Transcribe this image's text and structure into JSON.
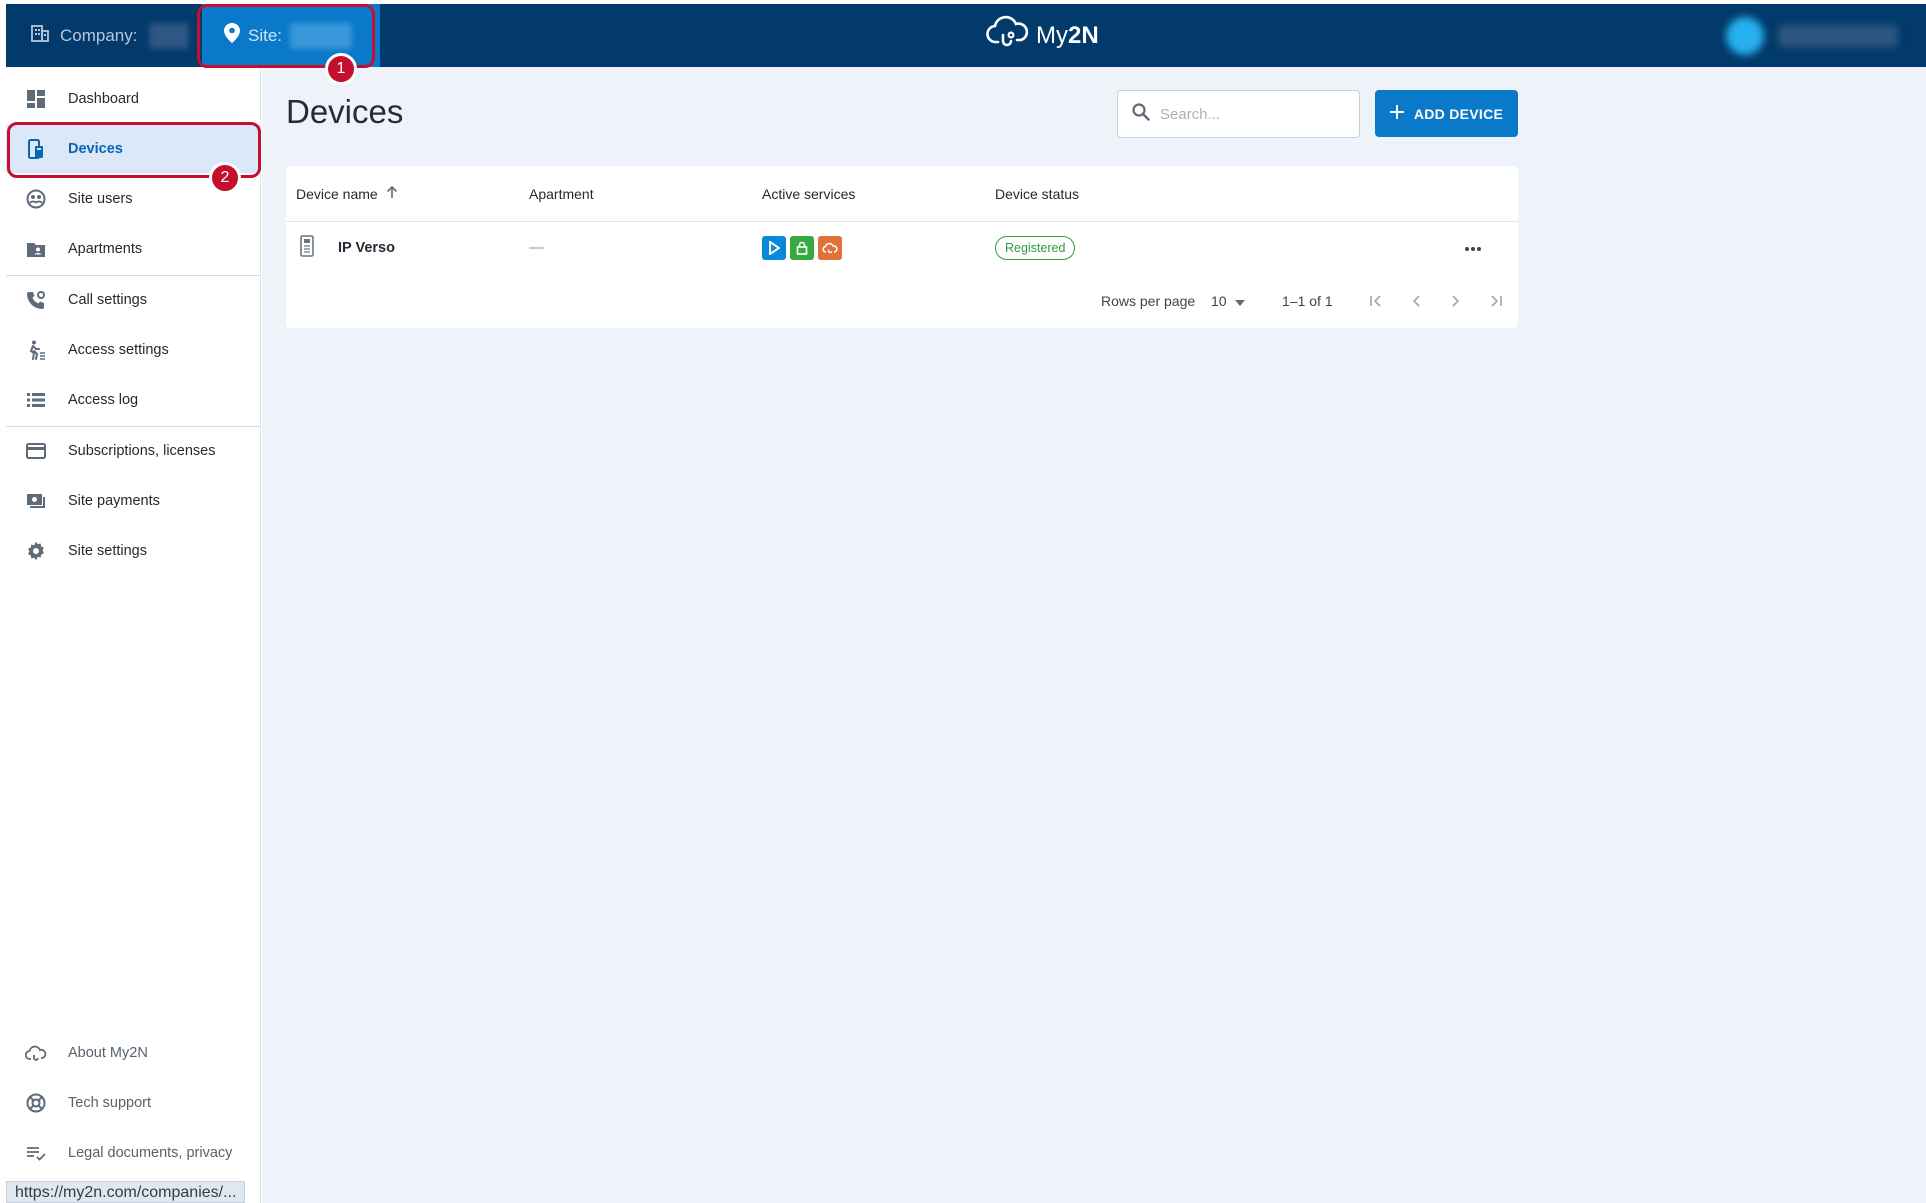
{
  "topbar": {
    "company_label": "Company:",
    "site_label": "Site:",
    "logo_prefix": "My",
    "logo_bold": "2N"
  },
  "annotations": {
    "badge1": "1",
    "badge2": "2"
  },
  "sidebar": {
    "items": [
      {
        "label": "Dashboard"
      },
      {
        "label": "Devices"
      },
      {
        "label": "Site users"
      },
      {
        "label": "Apartments"
      },
      {
        "label": "Call settings"
      },
      {
        "label": "Access settings"
      },
      {
        "label": "Access log"
      },
      {
        "label": "Subscriptions, licenses"
      },
      {
        "label": "Site payments"
      },
      {
        "label": "Site settings"
      }
    ],
    "footer": [
      {
        "label": "About My2N"
      },
      {
        "label": "Tech support"
      },
      {
        "label": "Legal documents, privacy"
      }
    ]
  },
  "main": {
    "title": "Devices",
    "search_placeholder": "Search...",
    "add_button": "ADD DEVICE",
    "table": {
      "columns": [
        "Device name",
        "Apartment",
        "Active services",
        "Device status"
      ],
      "rows": [
        {
          "device_name": "IP Verso",
          "apartment": "—",
          "status": "Registered"
        }
      ]
    },
    "pagination": {
      "rows_per_page_label": "Rows per page",
      "rows_per_page_value": "10",
      "range": "1–1 of 1"
    }
  },
  "statusbar": {
    "url": "https://my2n.com/companies/..."
  },
  "colors": {
    "accent": "#0a79c9",
    "topbar": "#013a6b",
    "highlight": "#c4102e",
    "registered": "#2f9d3c"
  }
}
